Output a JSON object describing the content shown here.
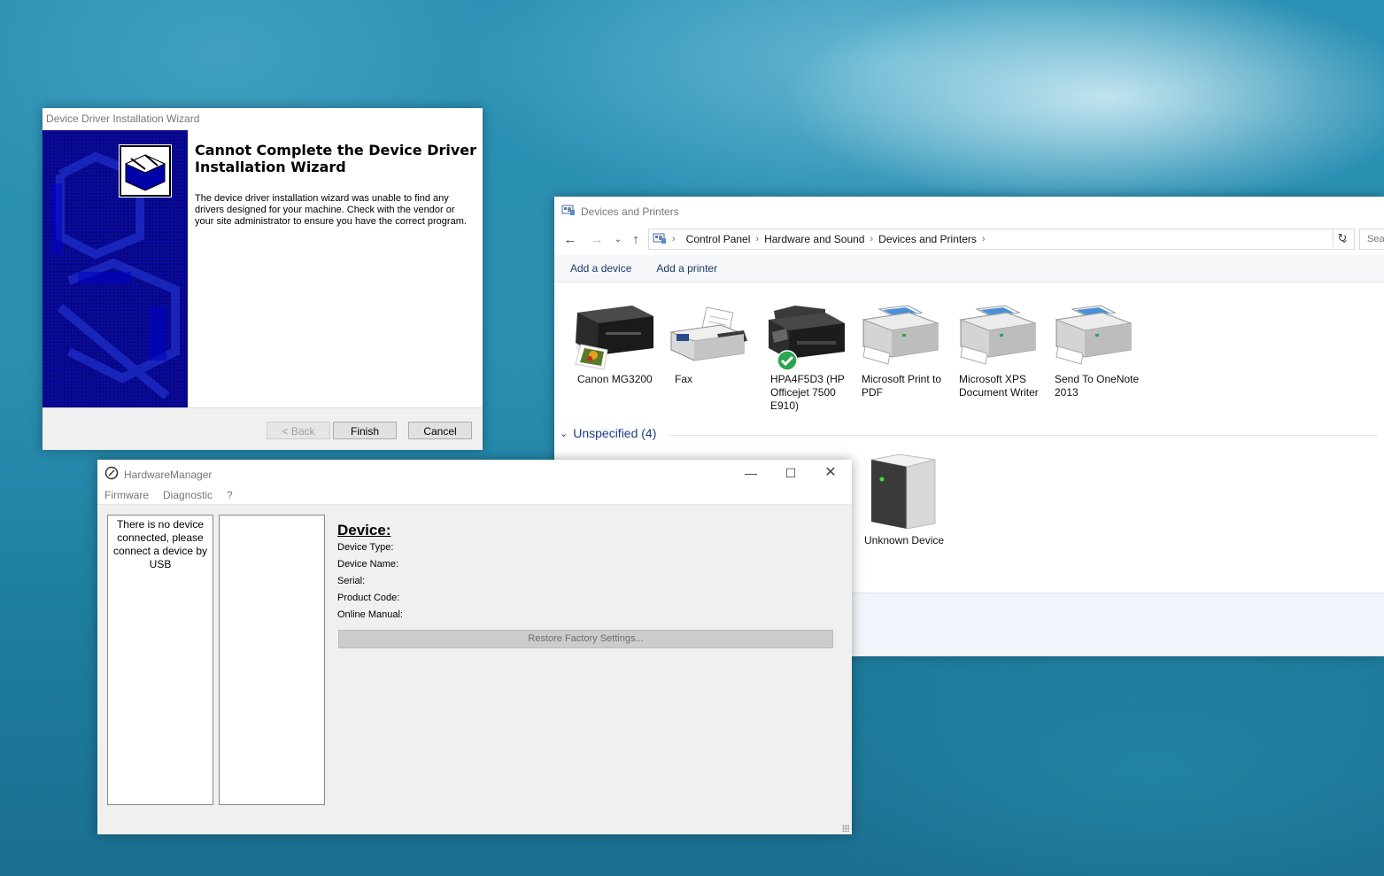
{
  "devices_printers": {
    "title": "Devices and Printers",
    "breadcrumb": [
      "Control Panel",
      "Hardware and Sound",
      "Devices and Printers"
    ],
    "search_placeholder": "Sea",
    "commands": [
      "Add a device",
      "Add a printer"
    ],
    "printers": [
      {
        "label": "Canon MG3200",
        "icon": "inkjet-printer-icon"
      },
      {
        "label": "Fax",
        "icon": "fax-icon"
      },
      {
        "label": "HPA4F5D3 (HP Officejet 7500 E910)",
        "icon": "officejet-printer-icon",
        "default": true
      },
      {
        "label": "Microsoft Print to PDF",
        "icon": "printer-icon"
      },
      {
        "label": "Microsoft XPS Document Writer",
        "icon": "printer-icon"
      },
      {
        "label": "Send To OneNote 2013",
        "icon": "printer-icon"
      }
    ],
    "unspecified_group": "Unspecified (4)",
    "unspecified_device": "Unknown Device"
  },
  "wizard": {
    "title": "Device Driver Installation Wizard",
    "heading": "Cannot Complete the Device Driver Installation Wizard",
    "body": "The device driver installation wizard was unable to find any drivers designed for your machine.  Check with the vendor or your site administrator to ensure you have the correct program.",
    "back_label": "< Back",
    "finish_label": "Finish",
    "cancel_label": "Cancel"
  },
  "hardware_manager": {
    "title": "HardwareManager",
    "menu": [
      "Firmware",
      "Diagnostic",
      "?"
    ],
    "no_device_message": "There is no device connected, please connect a device by USB",
    "device_heading": "Device:",
    "fields": [
      "Device Type:",
      "Device Name:",
      "Serial:",
      "Product Code:",
      "Online Manual:"
    ],
    "restore_label": "Restore Factory Settings..."
  }
}
